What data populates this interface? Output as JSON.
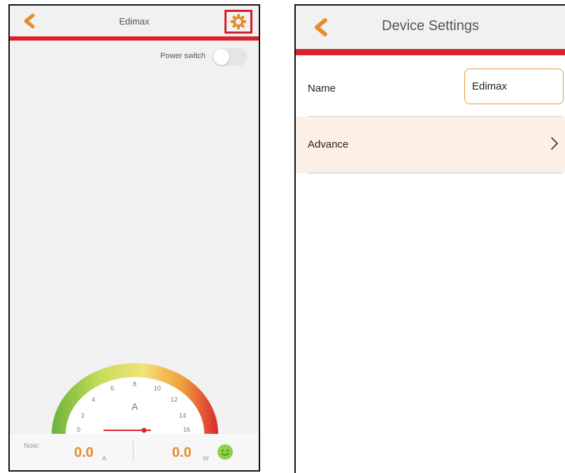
{
  "left_screen": {
    "title": "Edimax",
    "power_switch_label": "Power switch",
    "power_switch_on": false,
    "gauge": {
      "unit_label": "A",
      "ticks": [
        "0",
        "2",
        "4",
        "6",
        "8",
        "10",
        "12",
        "14",
        "16"
      ],
      "value": 0
    },
    "now_label": "Now:",
    "current_value": "0.0",
    "current_unit": "A",
    "power_value": "0.0",
    "power_unit": "W",
    "icons": {
      "back": "chevron-left-icon",
      "settings": "gear-icon",
      "status": "smiley-icon"
    },
    "colors": {
      "accent": "#ea8a2d",
      "highlight_box": "#d11f2a",
      "header_rule": "#d7232d"
    }
  },
  "right_screen": {
    "title": "Device Settings",
    "name_label": "Name",
    "name_value": "Edimax",
    "advance_label": "Advance",
    "icons": {
      "back": "chevron-left-icon",
      "advance": "chevron-right-icon"
    },
    "colors": {
      "row_highlight": "#fcefe6",
      "input_border": "#e99a43"
    }
  }
}
